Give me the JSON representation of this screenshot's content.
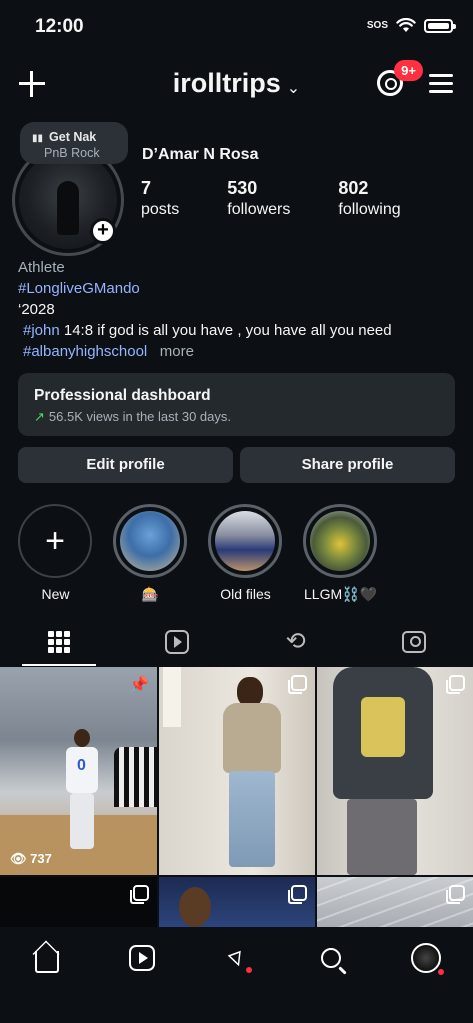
{
  "status": {
    "time": "12:00",
    "sos": "SOS"
  },
  "header": {
    "username": "irolltrips",
    "notification_badge": "9+"
  },
  "profile": {
    "full_name": "D’Amar N Rosa",
    "music_title": "Get Nak",
    "music_artist": "PnB Rock",
    "stats": {
      "posts_count": "7",
      "posts_label": "posts",
      "followers_count": "530",
      "followers_label": "followers",
      "following_count": "802",
      "following_label": "following"
    }
  },
  "bio": {
    "category": "Athlete",
    "hashtag1": "#LongliveGMando",
    "line_year": "‘2028",
    "hashtag2": "#john",
    "verse": " 14:8 if god is all you have , you have all you need",
    "hashtag3": "#albanyhighschool",
    "more": "more"
  },
  "dashboard": {
    "title": "Professional dashboard",
    "arrow": "↗",
    "views": "56.5K views in the last 30 days."
  },
  "buttons": {
    "edit": "Edit profile",
    "share": "Share profile"
  },
  "highlights": [
    {
      "label": "New"
    },
    {
      "label": "🎰"
    },
    {
      "label": "Old files"
    },
    {
      "label": "LLGM⛓️🖤"
    }
  ],
  "posts": {
    "view_count": "737"
  },
  "colors": {
    "background": "#0c1014",
    "link": "#93b4ff",
    "badge": "#ff3040",
    "trend": "#4cd964"
  },
  "icons": [
    "plus-icon",
    "threads-icon",
    "menu-icon",
    "grid-icon",
    "reels-icon",
    "repost-icon",
    "tagged-icon",
    "home-icon",
    "send-icon",
    "search-icon",
    "pin-icon",
    "eye-icon"
  ]
}
